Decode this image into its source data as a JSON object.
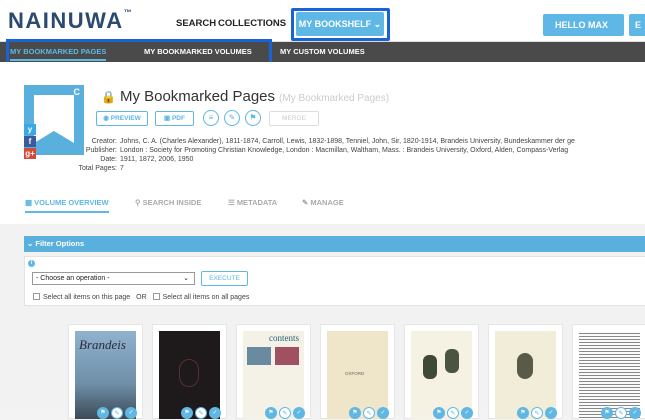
{
  "header": {
    "logo": "NAINUWA",
    "logo_tm": "™",
    "nav": [
      "SEARCH",
      "COLLECTIONS"
    ],
    "bookshelf_label": "MY BOOKSHELF",
    "user_label": "HELLO MAX",
    "edge_label": "E"
  },
  "subnav": {
    "items": [
      "MY BOOKMARKED PAGES",
      "MY BOOKMARKED VOLUMES",
      "MY CUSTOM VOLUMES"
    ],
    "active_index": 0
  },
  "collection": {
    "title": "My Bookmarked Pages",
    "title_paren": "(My Bookmarked Pages)",
    "cover_badge": "C",
    "social": [
      "y",
      "f",
      "g+"
    ],
    "actions": [
      "PREVIEW",
      "PDF"
    ],
    "disabled_action": "MERGE",
    "metadata": [
      {
        "label": "Creator:",
        "value": "Johns, C. A. (Charles Alexander), 1811-1874, Carroll, Lewis, 1832-1898, Tenniel, John, Sir, 1820-1914, Brandeis University, Bundeskammer der ge"
      },
      {
        "label": "Publisher:",
        "value": "London : Society for Promoting Christian Knowledge, London : Macmillan, Waltham, Mass. : Brandeis University, Oxford, Alden, Compass-Verlag"
      },
      {
        "label": "Date:",
        "value": "1911, 1872, 2006, 1950"
      },
      {
        "label": "Total Pages:",
        "value": "7"
      }
    ]
  },
  "tabs": [
    {
      "label": "VOLUME OVERVIEW",
      "icon": "grid-icon"
    },
    {
      "label": "SEARCH INSIDE",
      "icon": "search-icon"
    },
    {
      "label": "METADATA",
      "icon": "list-icon"
    },
    {
      "label": "MANAGE",
      "icon": "pencil-icon"
    }
  ],
  "filter": {
    "bar_label": "Filter Options",
    "select_value": "- Choose an operation -",
    "execute_label": "EXECUTE",
    "check_this_page": "Select all items on this page",
    "or_label": "OR",
    "check_all_pages": "Select all items on all pages"
  },
  "thumbnails": [
    {
      "name": "brandeis",
      "text": "Brandeis"
    },
    {
      "name": "dark-cover",
      "text": ""
    },
    {
      "name": "contents",
      "text": "contents"
    },
    {
      "name": "oxford",
      "text": "OXFORD"
    },
    {
      "name": "plant-plate",
      "text": ""
    },
    {
      "name": "flower-plate",
      "text": ""
    },
    {
      "name": "newspaper",
      "text": ""
    }
  ],
  "colors": {
    "accent": "#5fb7e5",
    "dark_bar": "#4a4a4a",
    "highlight_outline": "#1a63d6"
  }
}
